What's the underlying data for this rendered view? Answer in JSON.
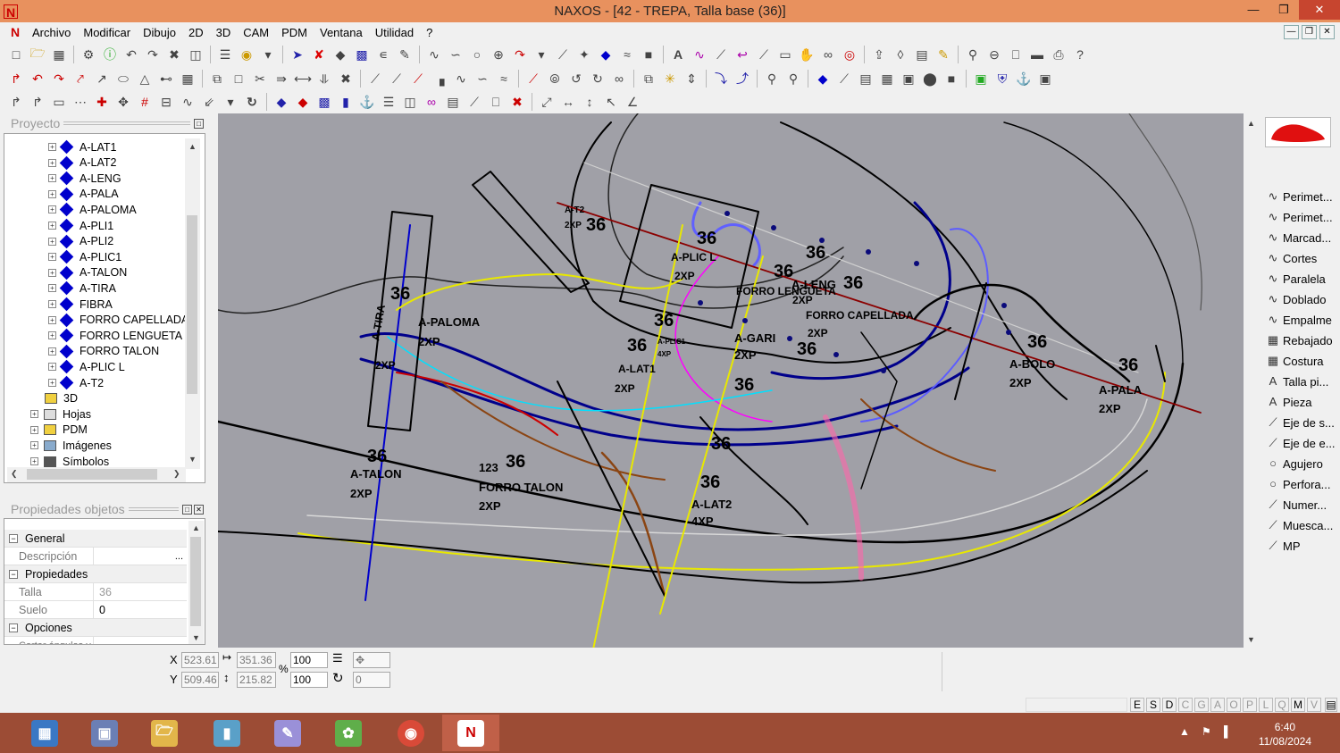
{
  "window": {
    "title": "NAXOS - [42 - TREPA, Talla base (36)]"
  },
  "menu": [
    "Archivo",
    "Modificar",
    "Dibujo",
    "2D",
    "3D",
    "CAM",
    "PDM",
    "Ventana",
    "Utilidad",
    "?"
  ],
  "project_panel": {
    "title": "Proyecto",
    "pieces": [
      "A-LAT1",
      "A-LAT2",
      "A-LENG",
      "A-PALA",
      "A-PALOMA",
      "A-PLI1",
      "A-PLI2",
      "A-PLIC1",
      "A-TALON",
      "A-TIRA",
      "FIBRA",
      "FORRO CAPELLADA",
      "FORRO LENGUETA",
      "FORRO TALON",
      "A-PLIC L",
      "A-T2"
    ],
    "folders": [
      "3D",
      "Hojas",
      "PDM",
      "Imágenes",
      "Símbolos"
    ]
  },
  "properties_panel": {
    "title": "Propiedades objetos",
    "general": {
      "label": "General",
      "description_key": "Descripción",
      "description_value": "",
      "ellipsis": "..."
    },
    "propiedades": {
      "label": "Propiedades",
      "talla_key": "Talla",
      "talla_value": "36",
      "suelo_key": "Suelo",
      "suelo_value": "0"
    },
    "opciones": {
      "label": "Opciones",
      "cut_key": "Cortar ángulos y"
    }
  },
  "coords": {
    "x_label": "X",
    "y_label": "Y",
    "x": "523.61",
    "y": "509.46",
    "w": "351.36",
    "h": "215.82",
    "scale_x": "100",
    "scale_y": "100",
    "percent": "%",
    "rotation": "0"
  },
  "right_tools": [
    "Perimet...",
    "Perimet...",
    "Marcad...",
    "Cortes",
    "Paralela",
    "Doblado",
    "Empalme",
    "Rebajado",
    "Costura",
    "Talla pi...",
    "Pieza",
    "Eje de s...",
    "Eje de e...",
    "Agujero",
    "Perfora...",
    "Numer...",
    "Muesca...",
    "MP"
  ],
  "status_letters": [
    "E",
    "S",
    "D",
    "C",
    "G",
    "A",
    "O",
    "P",
    "L",
    "Q",
    "M",
    "V"
  ],
  "clock": {
    "time": "6:40",
    "date": "11/08/2024"
  },
  "canvas_labels": [
    {
      "t": "A-T2"
    },
    {
      "t": "2XP"
    },
    {
      "t": "36"
    },
    {
      "t": "36"
    },
    {
      "t": "A-PLIC L"
    },
    {
      "t": "2XP"
    },
    {
      "t": "36"
    },
    {
      "t": "36"
    },
    {
      "t": "A-LENG"
    },
    {
      "t": "36"
    },
    {
      "t": "FORRO LENGUETA"
    },
    {
      "t": "2XP"
    },
    {
      "t": "FORRO CAPELLADA"
    },
    {
      "t": "2XP"
    },
    {
      "t": "36"
    },
    {
      "t": "A-BOLO"
    },
    {
      "t": "2XP"
    },
    {
      "t": "36"
    },
    {
      "t": "A-PALA"
    },
    {
      "t": "2XP"
    },
    {
      "t": "36"
    },
    {
      "t": "A-PALOMA"
    },
    {
      "t": "2XP"
    },
    {
      "t": "A-TIRA"
    },
    {
      "t": "2XP"
    },
    {
      "t": "36"
    },
    {
      "t": "36"
    },
    {
      "t": "A-GARI"
    },
    {
      "t": "2XP"
    },
    {
      "t": "36"
    },
    {
      "t": "A-PLIC1"
    },
    {
      "t": "4XP"
    },
    {
      "t": "A-LAT1"
    },
    {
      "t": "2XP"
    },
    {
      "t": "36"
    },
    {
      "t": "36"
    },
    {
      "t": "A-TALON"
    },
    {
      "t": "2XP"
    },
    {
      "t": "123"
    },
    {
      "t": "36"
    },
    {
      "t": "FORRO TALON"
    },
    {
      "t": "2XP"
    },
    {
      "t": "36"
    },
    {
      "t": "A-LAT2"
    },
    {
      "t": "4XP"
    },
    {
      "t": "36"
    }
  ]
}
